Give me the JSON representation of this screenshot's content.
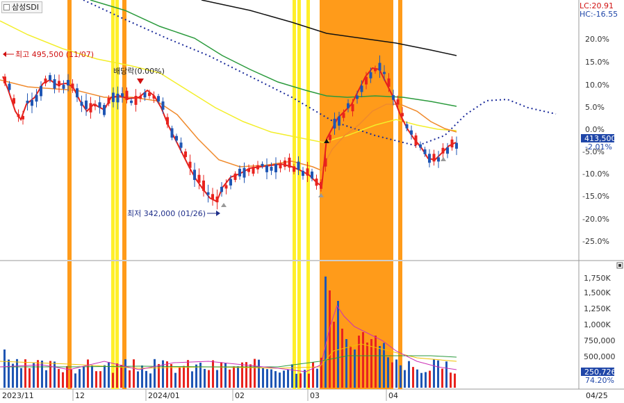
{
  "title": "삼성SDI",
  "lc_label": "LC:20.91",
  "hc_label": "HC:-16.55",
  "current_price_tag": "413,500",
  "current_pct_tag": "-2.01%",
  "volume_tag": "250,726",
  "volume_pct_tag": "74.20%",
  "high_annotation": "최고 495,500 (11/07)",
  "low_annotation": "최저 342,000 (01/26)",
  "dividend_annotation": "배당락(0.00%)",
  "price_axis_labels": [
    "20.0%",
    "15.0%",
    "10.0%",
    "5.0%",
    "0.0%",
    "-5.0%",
    "-10.0%",
    "-15.0%",
    "-20.0%",
    "-25.0%"
  ],
  "volume_axis_labels": [
    "1,750K",
    "1,500K",
    "1,250K",
    "1,000K",
    "750,000",
    "500,000"
  ],
  "date_labels": [
    "2023/11",
    "12",
    "2024/01",
    "02",
    "03",
    "04",
    "04/25"
  ],
  "colors": {
    "up": "#e8231e",
    "down": "#1f56b4",
    "orange_band": "#ff9b1a",
    "yellow_band": "#ffef2b",
    "ma_red": "#e4201c",
    "ma_orange": "#f08a2c",
    "ma_yellow": "#f3ee2a",
    "ma_green": "#2a9a3c",
    "ma_black": "#111111",
    "ma_dotted": "#1a2a9a"
  }
}
